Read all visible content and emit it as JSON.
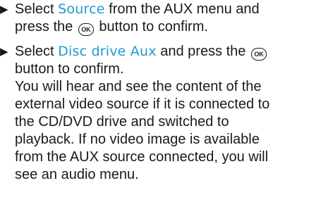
{
  "arrow_glyph": "▶",
  "ok_button_label": "OK",
  "step1": {
    "line1_before": "Select ",
    "line1_display": "Source",
    "line1_after": " from the AUX menu and",
    "line2_before": "press the ",
    "line2_after": " button to confirm."
  },
  "step2": {
    "line1_before": "Select ",
    "line1_display": "Disc drive Aux",
    "line1_after": " and press the ",
    "line2": "button to confirm.",
    "note_lines": [
      "You will hear and see the content of the",
      "external video source if it is connected to",
      "the CD/DVD drive and switched to",
      "playback. If no video image is available",
      "from the AUX source connected, you will",
      "see an audio menu."
    ]
  }
}
